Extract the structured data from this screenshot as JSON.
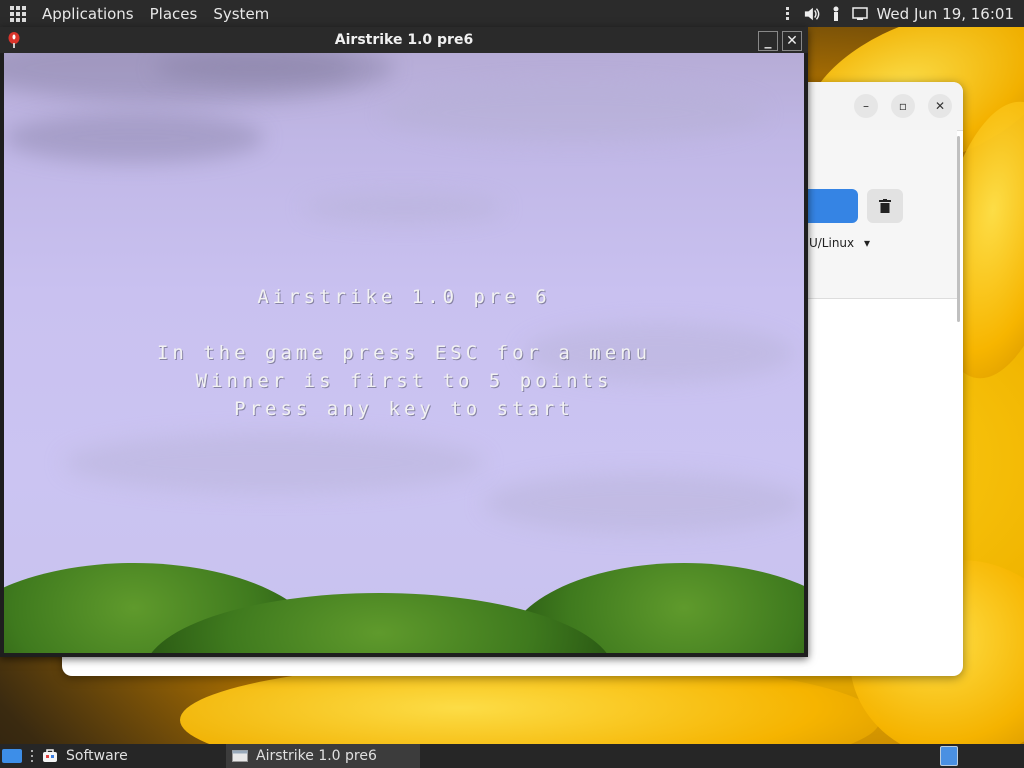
{
  "top_panel": {
    "menus": [
      "Applications",
      "Places",
      "System"
    ],
    "datetime": "Wed Jun 19, 16:01",
    "icons": [
      "apps-grid-icon",
      "overflow-icon",
      "volume-icon",
      "user-icon",
      "network-icon"
    ]
  },
  "background_window": {
    "dropdown_text": "NU/Linux",
    "buttons": [
      "minimize-icon",
      "maximize-icon",
      "close-icon",
      "trash-icon"
    ],
    "accent_color": "#3584e4"
  },
  "game_window": {
    "title": "Airstrike 1.0 pre6",
    "screen_text": {
      "title": "Airstrike 1.0 pre 6",
      "line1": "In the game press ESC for a menu",
      "line2": "Winner is first to 5 points",
      "line3": "Press any key to start"
    }
  },
  "taskbar": {
    "items": [
      {
        "label": "Software",
        "icon": "software-icon"
      },
      {
        "label": "Airstrike 1.0 pre6",
        "icon": "window-icon"
      }
    ]
  }
}
